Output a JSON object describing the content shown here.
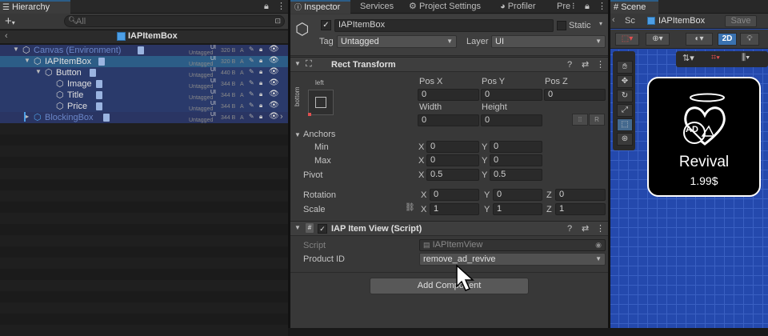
{
  "hierarchy": {
    "title": "Hierarchy",
    "search_placeholder": "All",
    "root": "IAPItemBox",
    "rows": [
      {
        "name": "Canvas (Environment)",
        "size": "320 B",
        "tag": "Untagged",
        "tag_flag": "UI",
        "depth": 0,
        "dim": true
      },
      {
        "name": "IAPItemBox",
        "size": "320 B",
        "tag": "Untagged",
        "tag_flag": "UI",
        "depth": 1,
        "selected": true
      },
      {
        "name": "Button",
        "size": "440 B",
        "tag": "Untagged",
        "tag_flag": "UI",
        "depth": 2
      },
      {
        "name": "Image",
        "size": "344 B",
        "tag": "Untagged",
        "tag_flag": "UI",
        "depth": 3
      },
      {
        "name": "Title",
        "size": "344 B",
        "tag": "Untagged",
        "tag_flag": "UI",
        "depth": 3
      },
      {
        "name": "Price",
        "size": "344 B",
        "tag": "Untagged",
        "tag_flag": "UI",
        "depth": 3
      },
      {
        "name": "BlockingBox",
        "size": "344 B",
        "tag": "Untagged",
        "tag_flag": "UI",
        "depth": 1,
        "dim": true
      }
    ],
    "row_A": "A"
  },
  "tabs": {
    "inspector": "Inspector",
    "services": "Services",
    "project_settings": "Project Settings",
    "profiler": "Profiler",
    "pre": "Pre"
  },
  "object": {
    "name": "IAPItemBox",
    "static_label": "Static",
    "tag_label": "Tag",
    "tag_value": "Untagged",
    "layer_label": "Layer",
    "layer_value": "UI"
  },
  "rect_transform": {
    "title": "Rect Transform",
    "anchor_h": "left",
    "anchor_v": "bottom",
    "pos_x_label": "Pos X",
    "pos_y_label": "Pos Y",
    "pos_z_label": "Pos Z",
    "pos_x": "0",
    "pos_y": "0",
    "pos_z": "0",
    "width_label": "Width",
    "height_label": "Height",
    "width": "0",
    "height": "0",
    "r_label": "R",
    "anchors_label": "Anchors",
    "min_label": "Min",
    "max_label": "Max",
    "min_x": "0",
    "min_y": "0",
    "max_x": "0",
    "max_y": "0",
    "pivot_label": "Pivot",
    "pivot_x": "0.5",
    "pivot_y": "0.5",
    "rotation_label": "Rotation",
    "rot_x": "0",
    "rot_y": "0",
    "rot_z": "0",
    "scale_label": "Scale",
    "scale_x": "1",
    "scale_y": "1",
    "scale_z": "1",
    "x": "X",
    "y": "Y",
    "z": "Z"
  },
  "iap_view": {
    "title": "IAP Item View (Script)",
    "script_label": "Script",
    "script_value": "IAPItemView",
    "product_label": "Product ID",
    "product_value": "remove_ad_revive"
  },
  "add_component": "Add Component",
  "scene": {
    "title": "Scene",
    "tab_short": "Sc",
    "prefab": "IAPItemBox",
    "save": "Save",
    "mode_2d": "2D"
  },
  "card": {
    "title": "Revival",
    "price": "1.99$",
    "ad_text": "AD"
  },
  "colors": {
    "selection": "#2c5d87",
    "scene_bg": "#2449ad",
    "grid": "#3a60c2"
  }
}
